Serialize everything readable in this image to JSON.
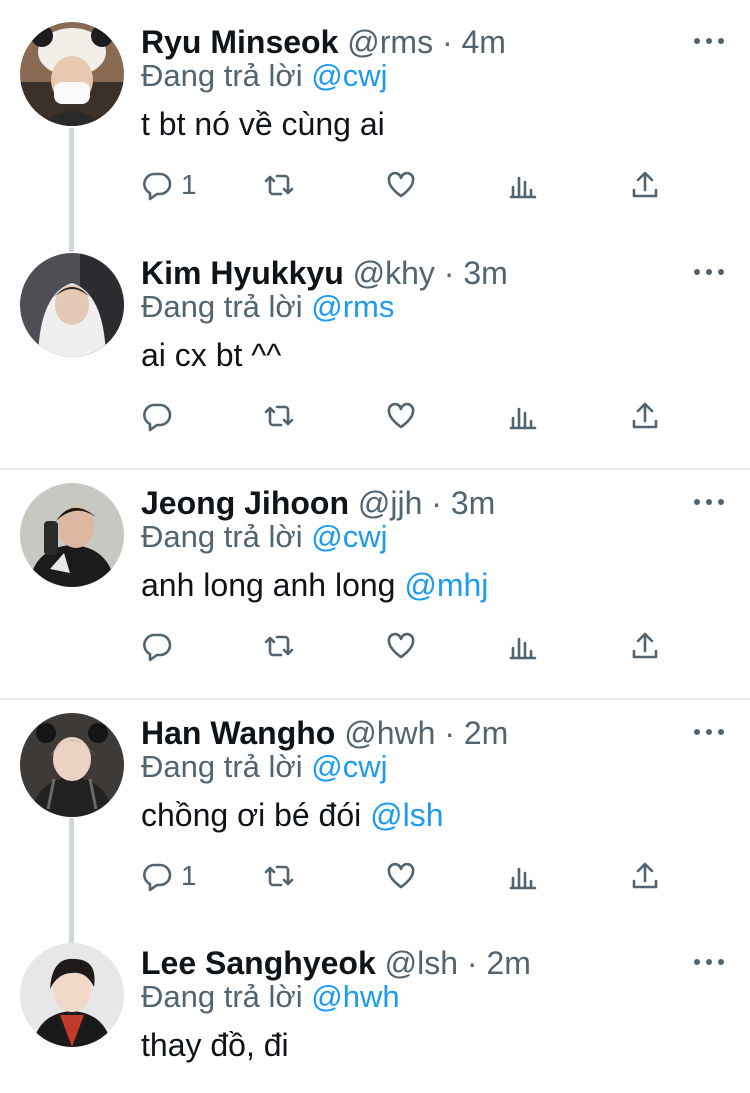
{
  "tweets": [
    {
      "avatar_icon": "profile-photo-icon",
      "name": "Ryu Minseok",
      "handle": "@rms",
      "dot": "·",
      "time": "4m",
      "reply_prefix": "Đang trả lời",
      "reply_to": "@cwj",
      "text": "t bt nó về cùng ai",
      "mention": "",
      "reply_count": "1"
    },
    {
      "avatar_icon": "profile-photo-icon",
      "name": "Kim Hyukkyu",
      "handle": "@khy",
      "dot": "·",
      "time": "3m",
      "reply_prefix": "Đang trả lời",
      "reply_to": "@rms",
      "text": "ai cx bt ^^",
      "mention": "",
      "reply_count": ""
    },
    {
      "avatar_icon": "profile-photo-icon",
      "name": "Jeong Jihoon",
      "handle": "@jjh",
      "dot": "·",
      "time": "3m",
      "reply_prefix": "Đang trả lời",
      "reply_to": "@cwj",
      "text": "anh long anh long ",
      "mention": "@mhj",
      "reply_count": ""
    },
    {
      "avatar_icon": "profile-photo-icon",
      "name": "Han Wangho",
      "handle": "@hwh",
      "dot": "·",
      "time": "2m",
      "reply_prefix": "Đang trả lời",
      "reply_to": "@cwj",
      "text": "chồng ơi bé đói ",
      "mention": "@lsh",
      "reply_count": "1"
    },
    {
      "avatar_icon": "profile-photo-icon",
      "name": "Lee Sanghyeok",
      "handle": "@lsh",
      "dot": "·",
      "time": "2m",
      "reply_prefix": "Đang trả lời",
      "reply_to": "@hwh",
      "text": "thay đồ, đi",
      "mention": "",
      "reply_count": ""
    }
  ],
  "icons": {
    "reply": "reply-icon",
    "retweet": "retweet-icon",
    "like": "heart-icon",
    "views": "analytics-icon",
    "share": "share-icon",
    "more": "more-icon"
  },
  "colors": {
    "link": "#1d9bf0",
    "secondary_text": "#536471",
    "primary_text": "#0f1419",
    "thread_line": "#cfd9de",
    "separator": "#e6eaed"
  }
}
